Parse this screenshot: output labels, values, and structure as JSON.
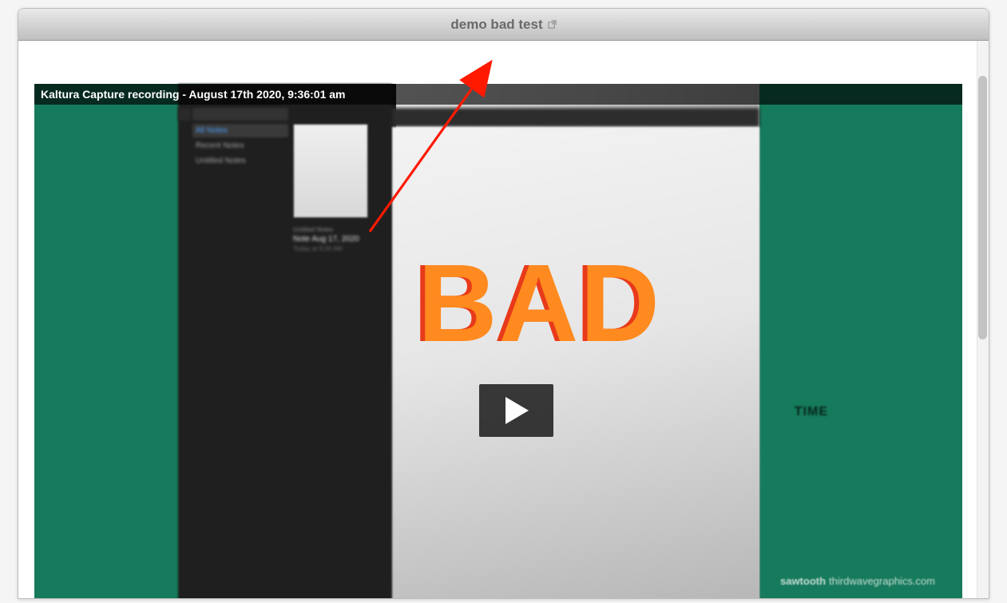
{
  "window": {
    "title": "demo bad test"
  },
  "video": {
    "title": "Kaltura Capture recording - August 17th 2020, 9:36:01 am",
    "overlay_text": "BAD",
    "background": {
      "time_label": "TIME",
      "watermark_brand": "sawtooth",
      "watermark_domain": "thirdwavegraphics.com",
      "sidebar": {
        "items": [
          {
            "label": "All Notes",
            "active": true
          },
          {
            "label": "Recent Notes",
            "active": false
          },
          {
            "label": "Untitled Notes",
            "active": false
          }
        ],
        "note_meta": {
          "folder": "Untitled Notes",
          "title": "Note Aug 17, 2020",
          "subtitle": "Today at 9:34 AM"
        }
      }
    }
  }
}
